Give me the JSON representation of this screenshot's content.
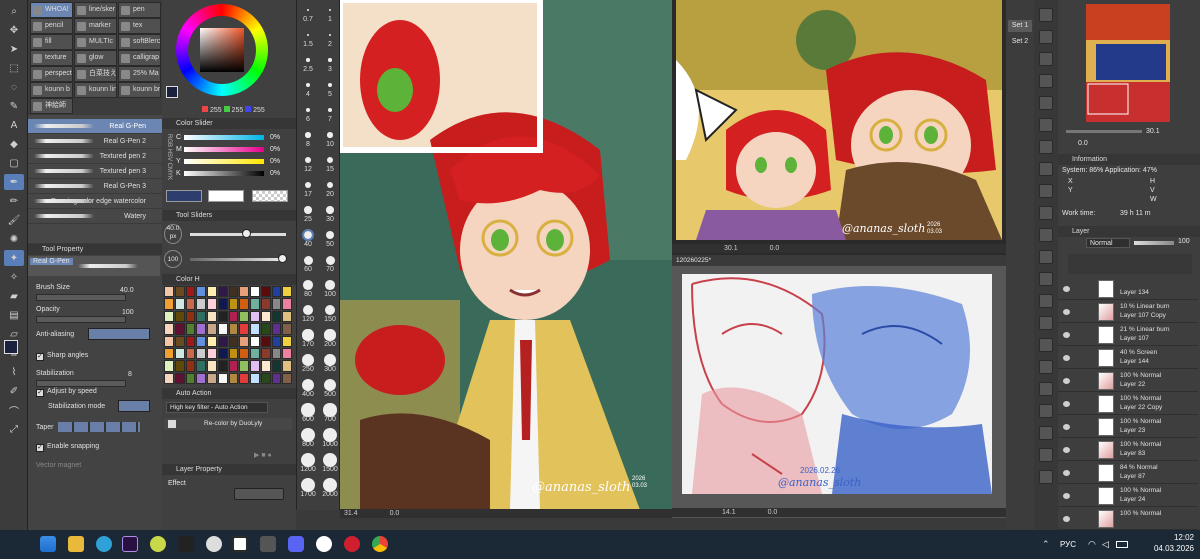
{
  "subtools": [
    {
      "label": "WHOA!"
    },
    {
      "label": "line/sker"
    },
    {
      "label": "pen"
    },
    {
      "label": "pencil"
    },
    {
      "label": "marker"
    },
    {
      "label": "tex"
    },
    {
      "label": "fill"
    },
    {
      "label": "MULTIc"
    },
    {
      "label": "softBlerc"
    },
    {
      "label": "texture"
    },
    {
      "label": "glow"
    },
    {
      "label": "calligrap"
    },
    {
      "label": "perspect"
    },
    {
      "label": "白菜技え"
    },
    {
      "label": "25% Ma"
    },
    {
      "label": "kounn b"
    },
    {
      "label": "kounn lin"
    },
    {
      "label": "kounn br"
    },
    {
      "label": "神絵師"
    }
  ],
  "brushes": [
    {
      "label": "Real G-Pen"
    },
    {
      "label": "Real G-Pen 2"
    },
    {
      "label": "Textured pen 2"
    },
    {
      "label": "Textured pen 3"
    },
    {
      "label": "Real G-Pen 3"
    },
    {
      "label": "Running color edge watercolor"
    },
    {
      "label": "Watery"
    }
  ],
  "tool_property": {
    "title": "Tool Property",
    "brush_name": "Real G-Pen",
    "brush_size_label": "Brush Size",
    "brush_size_value": "40.0",
    "opacity_label": "Opacity",
    "opacity_value": "100",
    "antialias_label": "Anti-aliasing",
    "sharp_angles": "Sharp angles",
    "stabilization_label": "Stabilization",
    "stabilization_value": "8",
    "adjust_speed": "Adjust by speed",
    "stabilization_mode": "Stabilization mode",
    "taper": "Taper",
    "enable_snapping": "Enable snapping",
    "vector_magnet": "Vector magnet"
  },
  "color_wheel": {
    "r": "255",
    "g": "255",
    "b": "255",
    "sub_r": "255"
  },
  "color_slider": {
    "title": "Color Slider",
    "side_label": "RGB HSV CMYK",
    "channels": [
      {
        "k": "C",
        "v": "0%"
      },
      {
        "k": "M",
        "v": "0%"
      },
      {
        "k": "Y",
        "v": "0%"
      },
      {
        "k": "K",
        "v": "0%"
      }
    ]
  },
  "tool_sliders": {
    "title": "Tool Sliders",
    "size": "40.0",
    "size_unit": "px",
    "opacity": "100"
  },
  "color_set": {
    "title": "Color H"
  },
  "auto_action": {
    "title": "Auto Action",
    "selected": "High key filter - Auto Action",
    "item": "Re-color by DuoLyly"
  },
  "layer_property": {
    "title": "Layer Property",
    "effect": "Effect"
  },
  "size_list": [
    "0.7",
    "1",
    "1.5",
    "2",
    "2.5",
    "3",
    "4",
    "5",
    "6",
    "7",
    "8",
    "10",
    "12",
    "15",
    "17",
    "20",
    "25",
    "30",
    "40",
    "50",
    "60",
    "70",
    "80",
    "100",
    "120",
    "150",
    "170",
    "200",
    "250",
    "300",
    "400",
    "500",
    "600",
    "700",
    "800",
    "1000",
    "1200",
    "1500",
    "1700",
    "2000"
  ],
  "canvas1": {
    "signature": "@ananas_sloth",
    "date": "2026 03.03",
    "zoom": "31.4",
    "pos": "0.0"
  },
  "canvas2": {
    "signature": "@ananas_sloth",
    "date": "2026 03.03",
    "zoom": "30.1",
    "pos": "0.0"
  },
  "canvas3": {
    "tab": "120260225*",
    "signature": "@ananas_sloth",
    "date": "2026.02.26",
    "zoom": "14.1",
    "pos": "0.0"
  },
  "sets": [
    "Set 1",
    "Set 2"
  ],
  "navigator": {
    "zoom": "30.1",
    "angle": "0.0"
  },
  "info": {
    "title": "Information",
    "system": "System: 86%  Application: 47%",
    "x": "X",
    "y": "Y",
    "h": "H",
    "v": "V",
    "w": "W",
    "worktime_label": "Work time:",
    "worktime": "39 h 11 m"
  },
  "layers_panel": {
    "title": "Layer",
    "blend": "Normal",
    "opacity": "100",
    "rows": [
      {
        "mode": "",
        "name": "Layer 134"
      },
      {
        "mode": "10 % Linear burn",
        "name": "Layer 107 Copy"
      },
      {
        "mode": "21 % Linear burn",
        "name": "Layer 107"
      },
      {
        "mode": "40 % Screen",
        "name": "Layer 144"
      },
      {
        "mode": "100 % Normal",
        "name": "Layer 22"
      },
      {
        "mode": "100 % Normal",
        "name": "Layer 22 Copy"
      },
      {
        "mode": "100 % Normal",
        "name": "Layer 23"
      },
      {
        "mode": "100 % Normal",
        "name": "Layer 83"
      },
      {
        "mode": "84 % Normal",
        "name": "Layer 87"
      },
      {
        "mode": "100 % Normal",
        "name": "Layer 24"
      },
      {
        "mode": "100 % Normal",
        "name": ""
      }
    ]
  },
  "taskbar": {
    "lang": "РУС",
    "time": "12:02",
    "date": "04.03.2026"
  },
  "colors": {
    "accent": "#5a7fb8",
    "panel": "#434343",
    "taskbar": "#1b2836"
  }
}
